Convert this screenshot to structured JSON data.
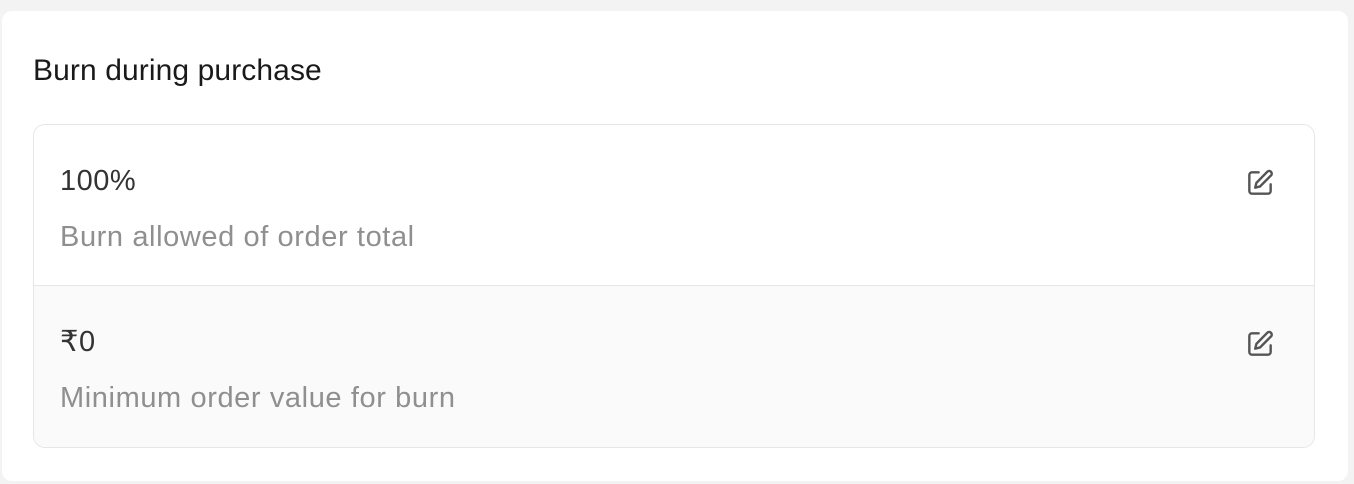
{
  "section": {
    "title": "Burn during purchase"
  },
  "settings": [
    {
      "value": "100%",
      "description": "Burn allowed of order total",
      "action_icon": "edit-icon"
    },
    {
      "value": "₹0",
      "description": "Minimum order value for burn",
      "action_icon": "edit-icon"
    }
  ],
  "colors": {
    "title_text": "#1a1a1a",
    "value_text": "#333333",
    "description_text": "#8f8f8f",
    "border": "#e6e6e6",
    "second_row_bg": "#fafafa"
  }
}
